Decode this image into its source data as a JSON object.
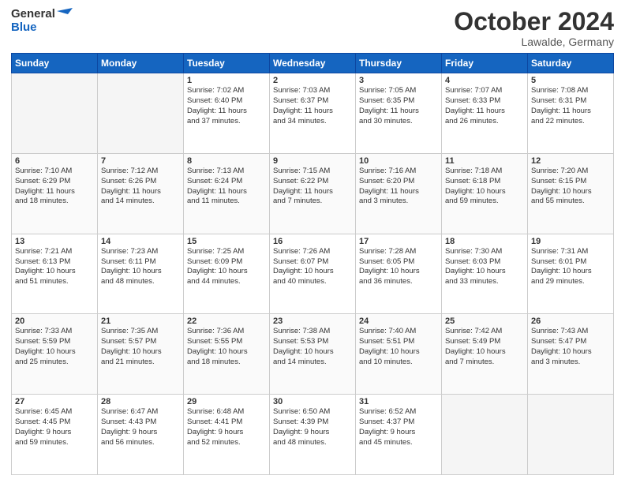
{
  "header": {
    "logo_line1": "General",
    "logo_line2": "Blue",
    "month": "October 2024",
    "location": "Lawalde, Germany"
  },
  "weekdays": [
    "Sunday",
    "Monday",
    "Tuesday",
    "Wednesday",
    "Thursday",
    "Friday",
    "Saturday"
  ],
  "weeks": [
    [
      {
        "day": "",
        "empty": true
      },
      {
        "day": "",
        "empty": true
      },
      {
        "day": "1",
        "line1": "Sunrise: 7:02 AM",
        "line2": "Sunset: 6:40 PM",
        "line3": "Daylight: 11 hours",
        "line4": "and 37 minutes."
      },
      {
        "day": "2",
        "line1": "Sunrise: 7:03 AM",
        "line2": "Sunset: 6:37 PM",
        "line3": "Daylight: 11 hours",
        "line4": "and 34 minutes."
      },
      {
        "day": "3",
        "line1": "Sunrise: 7:05 AM",
        "line2": "Sunset: 6:35 PM",
        "line3": "Daylight: 11 hours",
        "line4": "and 30 minutes."
      },
      {
        "day": "4",
        "line1": "Sunrise: 7:07 AM",
        "line2": "Sunset: 6:33 PM",
        "line3": "Daylight: 11 hours",
        "line4": "and 26 minutes."
      },
      {
        "day": "5",
        "line1": "Sunrise: 7:08 AM",
        "line2": "Sunset: 6:31 PM",
        "line3": "Daylight: 11 hours",
        "line4": "and 22 minutes."
      }
    ],
    [
      {
        "day": "6",
        "line1": "Sunrise: 7:10 AM",
        "line2": "Sunset: 6:29 PM",
        "line3": "Daylight: 11 hours",
        "line4": "and 18 minutes."
      },
      {
        "day": "7",
        "line1": "Sunrise: 7:12 AM",
        "line2": "Sunset: 6:26 PM",
        "line3": "Daylight: 11 hours",
        "line4": "and 14 minutes."
      },
      {
        "day": "8",
        "line1": "Sunrise: 7:13 AM",
        "line2": "Sunset: 6:24 PM",
        "line3": "Daylight: 11 hours",
        "line4": "and 11 minutes."
      },
      {
        "day": "9",
        "line1": "Sunrise: 7:15 AM",
        "line2": "Sunset: 6:22 PM",
        "line3": "Daylight: 11 hours",
        "line4": "and 7 minutes."
      },
      {
        "day": "10",
        "line1": "Sunrise: 7:16 AM",
        "line2": "Sunset: 6:20 PM",
        "line3": "Daylight: 11 hours",
        "line4": "and 3 minutes."
      },
      {
        "day": "11",
        "line1": "Sunrise: 7:18 AM",
        "line2": "Sunset: 6:18 PM",
        "line3": "Daylight: 10 hours",
        "line4": "and 59 minutes."
      },
      {
        "day": "12",
        "line1": "Sunrise: 7:20 AM",
        "line2": "Sunset: 6:15 PM",
        "line3": "Daylight: 10 hours",
        "line4": "and 55 minutes."
      }
    ],
    [
      {
        "day": "13",
        "line1": "Sunrise: 7:21 AM",
        "line2": "Sunset: 6:13 PM",
        "line3": "Daylight: 10 hours",
        "line4": "and 51 minutes."
      },
      {
        "day": "14",
        "line1": "Sunrise: 7:23 AM",
        "line2": "Sunset: 6:11 PM",
        "line3": "Daylight: 10 hours",
        "line4": "and 48 minutes."
      },
      {
        "day": "15",
        "line1": "Sunrise: 7:25 AM",
        "line2": "Sunset: 6:09 PM",
        "line3": "Daylight: 10 hours",
        "line4": "and 44 minutes."
      },
      {
        "day": "16",
        "line1": "Sunrise: 7:26 AM",
        "line2": "Sunset: 6:07 PM",
        "line3": "Daylight: 10 hours",
        "line4": "and 40 minutes."
      },
      {
        "day": "17",
        "line1": "Sunrise: 7:28 AM",
        "line2": "Sunset: 6:05 PM",
        "line3": "Daylight: 10 hours",
        "line4": "and 36 minutes."
      },
      {
        "day": "18",
        "line1": "Sunrise: 7:30 AM",
        "line2": "Sunset: 6:03 PM",
        "line3": "Daylight: 10 hours",
        "line4": "and 33 minutes."
      },
      {
        "day": "19",
        "line1": "Sunrise: 7:31 AM",
        "line2": "Sunset: 6:01 PM",
        "line3": "Daylight: 10 hours",
        "line4": "and 29 minutes."
      }
    ],
    [
      {
        "day": "20",
        "line1": "Sunrise: 7:33 AM",
        "line2": "Sunset: 5:59 PM",
        "line3": "Daylight: 10 hours",
        "line4": "and 25 minutes."
      },
      {
        "day": "21",
        "line1": "Sunrise: 7:35 AM",
        "line2": "Sunset: 5:57 PM",
        "line3": "Daylight: 10 hours",
        "line4": "and 21 minutes."
      },
      {
        "day": "22",
        "line1": "Sunrise: 7:36 AM",
        "line2": "Sunset: 5:55 PM",
        "line3": "Daylight: 10 hours",
        "line4": "and 18 minutes."
      },
      {
        "day": "23",
        "line1": "Sunrise: 7:38 AM",
        "line2": "Sunset: 5:53 PM",
        "line3": "Daylight: 10 hours",
        "line4": "and 14 minutes."
      },
      {
        "day": "24",
        "line1": "Sunrise: 7:40 AM",
        "line2": "Sunset: 5:51 PM",
        "line3": "Daylight: 10 hours",
        "line4": "and 10 minutes."
      },
      {
        "day": "25",
        "line1": "Sunrise: 7:42 AM",
        "line2": "Sunset: 5:49 PM",
        "line3": "Daylight: 10 hours",
        "line4": "and 7 minutes."
      },
      {
        "day": "26",
        "line1": "Sunrise: 7:43 AM",
        "line2": "Sunset: 5:47 PM",
        "line3": "Daylight: 10 hours",
        "line4": "and 3 minutes."
      }
    ],
    [
      {
        "day": "27",
        "line1": "Sunrise: 6:45 AM",
        "line2": "Sunset: 4:45 PM",
        "line3": "Daylight: 9 hours",
        "line4": "and 59 minutes."
      },
      {
        "day": "28",
        "line1": "Sunrise: 6:47 AM",
        "line2": "Sunset: 4:43 PM",
        "line3": "Daylight: 9 hours",
        "line4": "and 56 minutes."
      },
      {
        "day": "29",
        "line1": "Sunrise: 6:48 AM",
        "line2": "Sunset: 4:41 PM",
        "line3": "Daylight: 9 hours",
        "line4": "and 52 minutes."
      },
      {
        "day": "30",
        "line1": "Sunrise: 6:50 AM",
        "line2": "Sunset: 4:39 PM",
        "line3": "Daylight: 9 hours",
        "line4": "and 48 minutes."
      },
      {
        "day": "31",
        "line1": "Sunrise: 6:52 AM",
        "line2": "Sunset: 4:37 PM",
        "line3": "Daylight: 9 hours",
        "line4": "and 45 minutes."
      },
      {
        "day": "",
        "empty": true
      },
      {
        "day": "",
        "empty": true
      }
    ]
  ]
}
